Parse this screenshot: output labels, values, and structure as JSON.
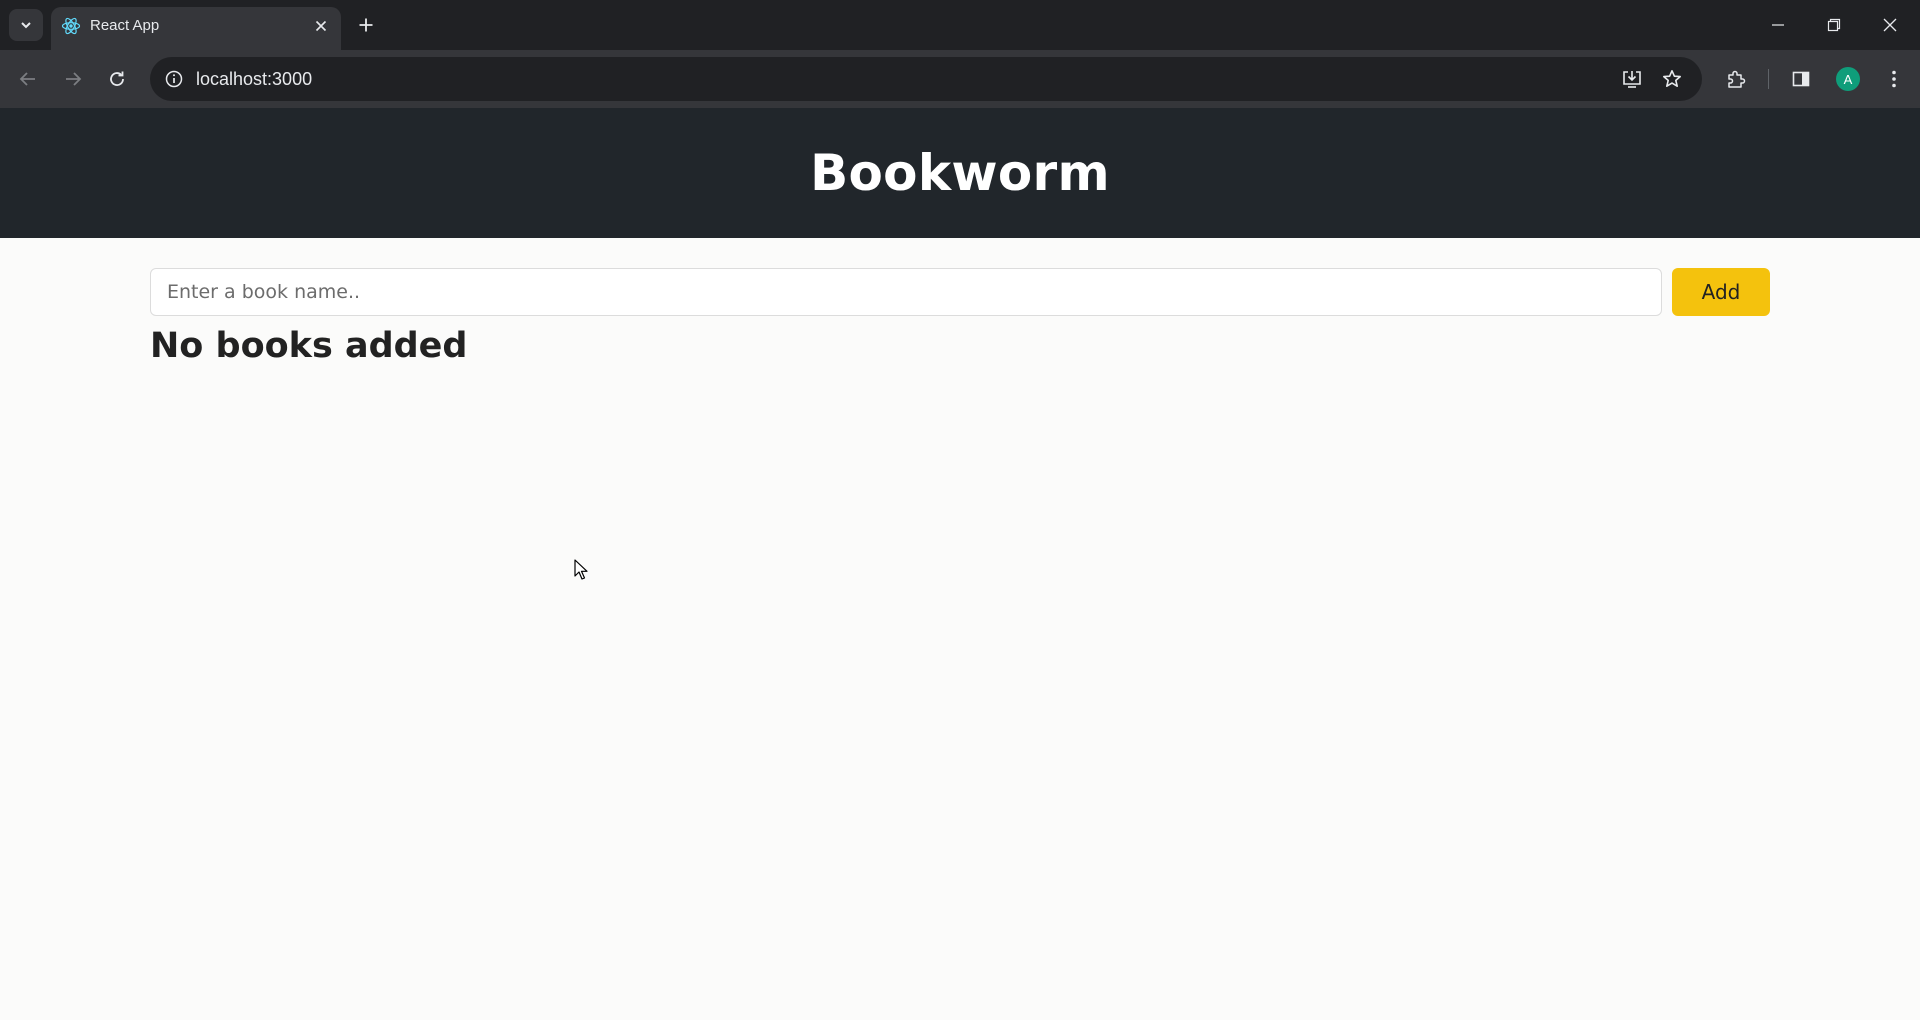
{
  "browser": {
    "tab": {
      "title": "React App",
      "favicon": "react-logo-icon"
    },
    "url": "localhost:3000",
    "profile_initial": "A",
    "icons": [
      "tab-search-icon",
      "close-icon",
      "plus-icon",
      "minimize-icon",
      "restore-icon",
      "back-icon",
      "forward-icon",
      "reload-icon",
      "info-icon",
      "install-app-icon",
      "star-icon",
      "extensions-icon",
      "side-panel-icon",
      "more-icon"
    ]
  },
  "app": {
    "title": "Bookworm",
    "input_placeholder": "Enter a book name..",
    "input_value": "",
    "add_label": "Add",
    "empty_message": "No books added"
  },
  "colors": {
    "header_bg": "#21262b",
    "accent": "#f4c20d",
    "page_bg": "#fbfbfa"
  }
}
